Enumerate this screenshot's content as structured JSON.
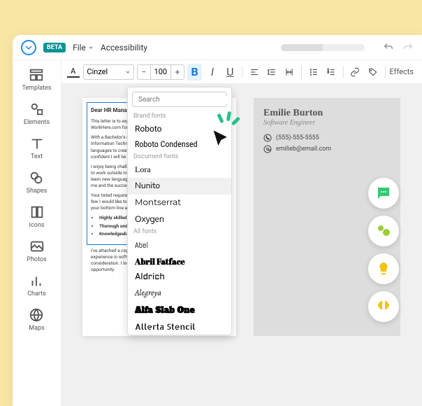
{
  "topbar": {
    "beta": "BETA",
    "file": "File",
    "accessibility": "Accessibility"
  },
  "sidebar": [
    {
      "label": "Templates"
    },
    {
      "label": "Elements"
    },
    {
      "label": "Text"
    },
    {
      "label": "Shapes"
    },
    {
      "label": "Icons"
    },
    {
      "label": "Photos"
    },
    {
      "label": "Charts"
    },
    {
      "label": "Maps"
    }
  ],
  "toolbar": {
    "font": "Cinzel",
    "size": "100",
    "effects": "Effects"
  },
  "dropdown": {
    "search_placeholder": "Search",
    "section_brand": "Brand fonts",
    "brand": [
      "Roboto",
      "Roboto Condensed"
    ],
    "section_doc": "Document fonts",
    "doc": [
      "Lora",
      "Nunito",
      "Montserrat",
      "Oxygen"
    ],
    "section_all": "All fonts",
    "all": [
      "Abel",
      "Abril Fatface",
      "Aldrich",
      "Alegreya",
      "Alfa Slab One",
      "Allerta Stencil"
    ]
  },
  "document": {
    "greeting": "Dear HR Manager:",
    "p1": "This letter is to express my interest in your posting on WorkHere.com for an experienced Software Developer.",
    "p2": "With a Bachelor's degree in Computer Science, Master's degree in Information Technology, and hands-on experience using .Net languages to create and implement software applications, I am confident I will be an asset to your organization.",
    "p3": "I enjoy being challenged and engaging with projects that require me to work outside my comfort and knowledge set, as continuing to learn new languages and development techniques are important to me and the success of your organization.",
    "p4": "Your listed requirements closely match my background and skills. A few I would like to highlight that would enable me to contribute to your bottom line are:",
    "bullets": [
      "Highly skilled in designing, testing, and developing software",
      "Thorough understanding of data structures and algorithms",
      "Knowledgeable of back-end development best practices"
    ],
    "p5": "I've attached a copy of my resume that details my projects and experience in software development. Thank you for your time and consideration. I look forward to speaking with you about this opportunity."
  },
  "profile": {
    "name": "Emilie Burton",
    "role": "Software Engineer",
    "phone": "(555)-555-5555",
    "email": "emilieb@email.com"
  }
}
